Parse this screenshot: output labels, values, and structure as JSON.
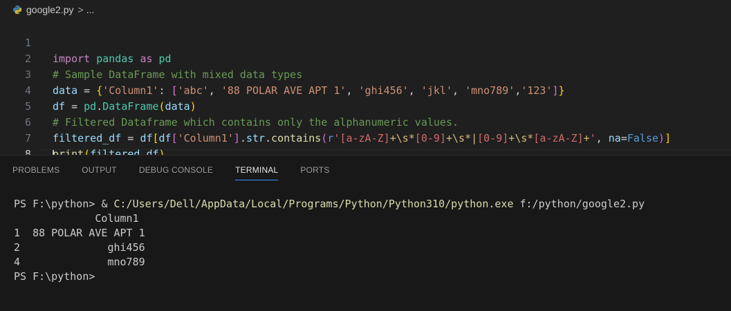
{
  "breadcrumb": {
    "file": "google2.py",
    "separator": ">",
    "more": "..."
  },
  "editor": {
    "line_numbers": [
      "1",
      "2",
      "3",
      "4",
      "5",
      "6",
      "7",
      "8"
    ],
    "line1": {
      "kw1": "import",
      "mod": "pandas",
      "kw2": "as",
      "alias": "pd"
    },
    "line2": {
      "comment": "# Sample DataFrame with mixed data types"
    },
    "line3": {
      "var": "data",
      "eq": " = ",
      "lbrace": "{",
      "key": "'Column1'",
      "colon": ": ",
      "lbrack": "[",
      "s1": "'abc'",
      "s2": "'88 POLAR AVE APT 1'",
      "s3": "'ghi456'",
      "s4": "'jkl'",
      "s5": "'mno789'",
      "s6": "'123'",
      "rbrack": "]",
      "rbrace": "}"
    },
    "line4": {
      "var": "df",
      "eq": " = ",
      "mod": "pd",
      "cls": "DataFrame",
      "arg": "data"
    },
    "line5": {
      "comment": "# Filtered Dataframe which contains only the alphanumeric values."
    },
    "line6": {
      "var": "filtered_df",
      "eq": " = ",
      "df1": "df",
      "df2": "df",
      "key": "'Column1'",
      "str": "str",
      "fn": "contains",
      "rprefix": "r",
      "q": "'",
      "cls1": "[a-zA-Z]",
      "plus": "+",
      "ws": "\\s",
      "star": "*",
      "cls2": "[0-9]",
      "pipe": "|",
      "param": "na",
      "val": "False"
    },
    "line7": {
      "fn": "print",
      "arg": "filtered_df"
    }
  },
  "panel": {
    "tabs": [
      "PROBLEMS",
      "OUTPUT",
      "DEBUG CONSOLE",
      "TERMINAL",
      "PORTS"
    ],
    "active_tab": "TERMINAL"
  },
  "terminal": {
    "prompt": "PS F:\\python> ",
    "amp": "& ",
    "exe": "C:/Users/Dell/AppData/Local/Programs/Python/Python310/python.exe",
    "script": " f:/python/google2.py",
    "header": "             Column1",
    "rows": [
      "1  88 POLAR AVE APT 1",
      "2              ghi456",
      "4              mno789"
    ],
    "final_prompt": "PS F:\\python>"
  }
}
